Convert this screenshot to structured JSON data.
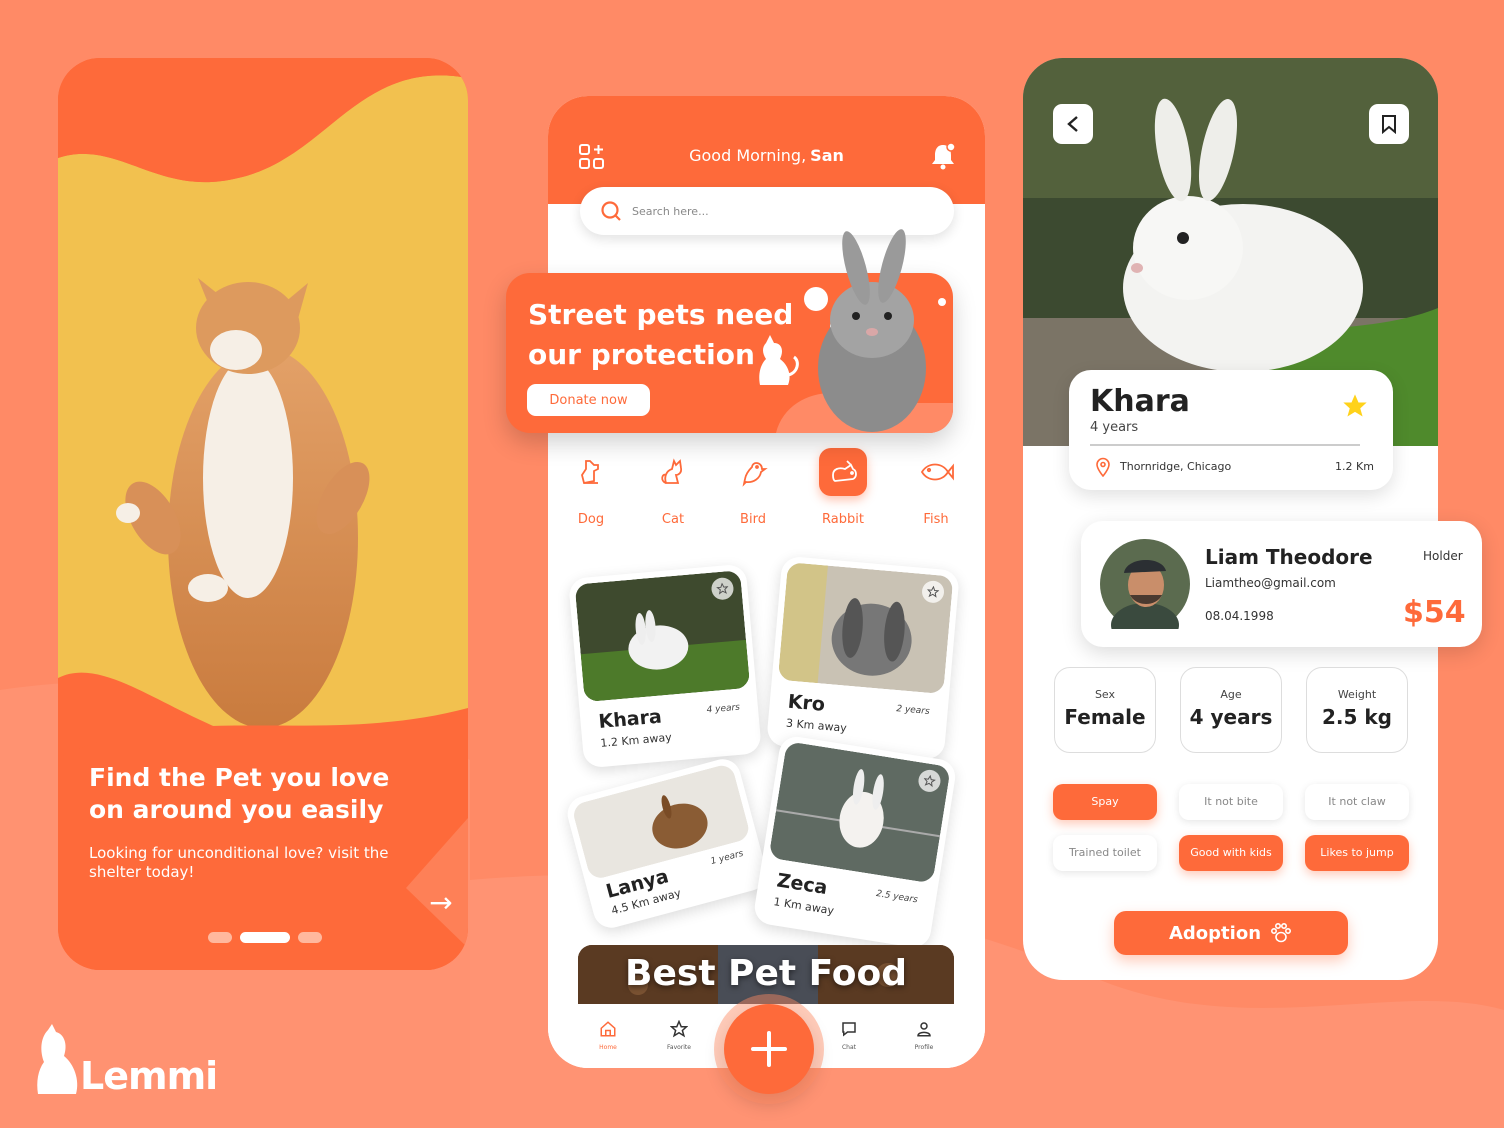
{
  "onboarding": {
    "title": "Find the Pet you love on around you easily",
    "subtitle": "Looking for unconditional love? visit the shelter today!",
    "page_count": 3,
    "active_page": 2
  },
  "brand": {
    "name": "Lemmi",
    "accent": "#fe6a3a",
    "secondary": "#f2c14f"
  },
  "home": {
    "greeting": "Good Morning,",
    "user": "San",
    "search_placeholder": "Search here...",
    "banner": {
      "title": "Street pets need our protection",
      "button": "Donate now"
    },
    "categories": [
      {
        "label": "Dog",
        "icon": "dog-icon",
        "active": false
      },
      {
        "label": "Cat",
        "icon": "cat-icon",
        "active": false
      },
      {
        "label": "Bird",
        "icon": "bird-icon",
        "active": false
      },
      {
        "label": "Rabbit",
        "icon": "rabbit-icon",
        "active": true
      },
      {
        "label": "Fish",
        "icon": "fish-icon",
        "active": false
      }
    ],
    "pets": [
      {
        "name": "Khara",
        "distance": "1.2 Km away",
        "age": "4 years"
      },
      {
        "name": "Kro",
        "distance": "3 Km away",
        "age": "2 years"
      },
      {
        "name": "Lanya",
        "distance": "4.5 Km away",
        "age": "1 years"
      },
      {
        "name": "Zeca",
        "distance": "1 Km away",
        "age": "2.5 years"
      }
    ],
    "promo": "Best Pet Food",
    "nav": [
      {
        "label": "Home",
        "icon": "home-icon",
        "active": true
      },
      {
        "label": "Favorite",
        "icon": "star-icon",
        "active": false
      },
      {
        "label": "Chat",
        "icon": "chat-icon",
        "active": false
      },
      {
        "label": "Profile",
        "icon": "profile-icon",
        "active": false
      }
    ]
  },
  "detail": {
    "name": "Khara",
    "age": "4 years",
    "location": "Thornridge, Chicago",
    "distance": "1.2 Km",
    "holder": {
      "name": "Liam Theodore",
      "email": "Liamtheo@gmail.com",
      "date": "08.04.1998",
      "role": "Holder",
      "price": "$54"
    },
    "stats": [
      {
        "label": "Sex",
        "value": "Female"
      },
      {
        "label": "Age",
        "value": "4 years"
      },
      {
        "label": "Weight",
        "value": "2.5 kg"
      }
    ],
    "tags": [
      {
        "label": "Spay",
        "on": true
      },
      {
        "label": "It not bite",
        "on": false
      },
      {
        "label": "It not claw",
        "on": false
      },
      {
        "label": "Trained toilet",
        "on": false
      },
      {
        "label": "Good with kids",
        "on": true
      },
      {
        "label": "Likes to jump",
        "on": true
      }
    ],
    "cta": "Adoption"
  }
}
